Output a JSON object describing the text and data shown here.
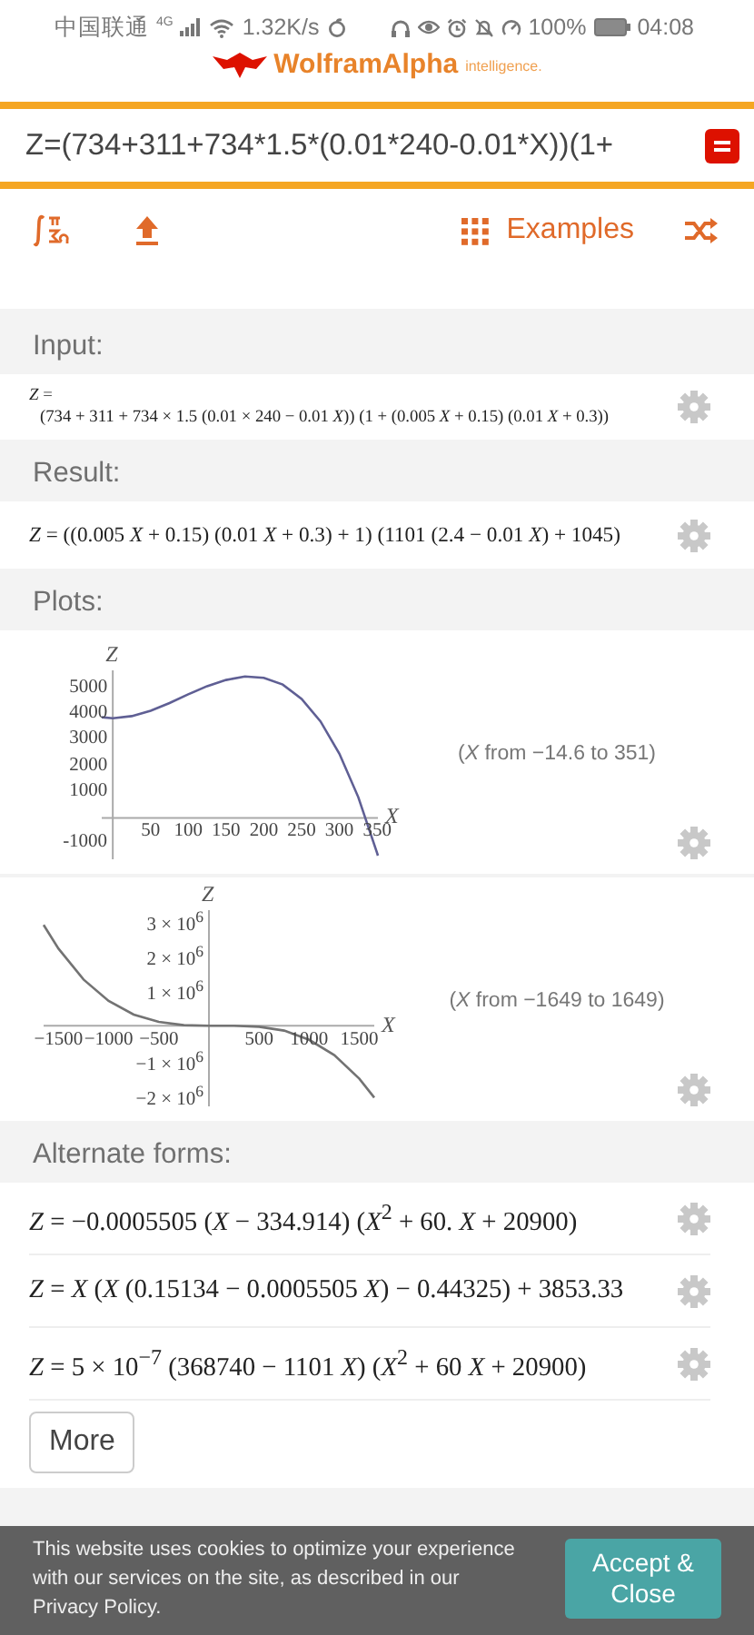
{
  "status_bar": {
    "carrier": "中国联通",
    "network": "4G",
    "speed": "1.32K/s",
    "battery": "100%",
    "time": "04:08"
  },
  "header": {
    "logo": "WolframAlpha",
    "tagline": "intelligence."
  },
  "search": {
    "value": "Z=(734+311+734*1.5*(0.01*240-0.01*X))(1+"
  },
  "toolbar": {
    "examples": "Examples"
  },
  "pods": [
    {
      "kind": "formula",
      "title": "Input:",
      "lines": [
        "*Z* =",
        "(734 + 311 + 734 × 1.5 (0.01 × 240 − 0.01 *X*)) (1 + (0.005 *X* + 0.15) (0.01 *X* + 0.3))"
      ]
    },
    {
      "kind": "formula",
      "title": "Result:",
      "lines": [
        "*Z* = ((0.005 *X* + 0.15) (0.01 *X* + 0.3) + 1) (1101 (2.4 − 0.01 *X*) + 1045)"
      ]
    },
    {
      "kind": "plots",
      "title": "Plots:",
      "plots": [
        {
          "range_note": "(*X* from −14.6 to 351)",
          "chart_data": {
            "type": "line",
            "xlabel": "X",
            "ylabel": "Z",
            "x": [
              -14.6,
              0,
              25,
              50,
              75,
              100,
              125,
              150,
              175,
              200,
              225,
              250,
              275,
              300,
              325,
              350,
              351
            ],
            "series": [
              {
                "color": "#5f5f94",
                "values": [
                  3890,
                  3850,
                  3930,
                  4140,
                  4440,
                  4770,
                  5090,
                  5330,
                  5460,
                  5410,
                  5150,
                  4600,
                  3730,
                  2480,
                  800,
                  -1370,
                  -1460
                ]
              }
            ],
            "xlim": [
              -14.6,
              351
            ],
            "ylim": [
              -1600,
              5700
            ],
            "xticks": [
              50,
              100,
              150,
              200,
              250,
              300,
              350
            ],
            "yticks": [
              {
                "value": -1000,
                "label": "-1000"
              },
              1000,
              2000,
              3000,
              4000,
              5000
            ]
          }
        },
        {
          "range_note": "(*X* from −1649 to 1649)",
          "chart_data": {
            "type": "line",
            "xlabel": "X",
            "ylabel": "Z",
            "x": [
              -1649,
              -1500,
              -1250,
              -1000,
              -750,
              -500,
              -250,
              0,
              250,
              500,
              750,
              1000,
              1250,
              1500,
              1649
            ],
            "series": [
              {
                "color": "#737373",
                "values": [
                  2880000,
                  2200000,
                  1320000,
                  710000,
                  320000,
                  110000,
                  20000,
                  0,
                  0,
                  -30000,
                  -140000,
                  -400000,
                  -840000,
                  -1510000,
                  -2050000
                ]
              }
            ],
            "xlim": [
              -1649,
              1649
            ],
            "ylim": [
              -2300000,
              3300000
            ],
            "xticks": [
              {
                "value": -1500,
                "label": "−1500"
              },
              {
                "value": -1000,
                "label": "−1000"
              },
              {
                "value": -500,
                "label": "−500"
              },
              500,
              1000,
              1500
            ],
            "yticks": [
              {
                "value": 3000000,
                "label": "3 × 10$^{6}$"
              },
              {
                "value": 2000000,
                "label": "2 × 10$^{6}$"
              },
              {
                "value": 1000000,
                "label": "1 × 10$^{6}$"
              },
              {
                "value": -1000000,
                "label": "−1 × 10$^{6}$"
              },
              {
                "value": -2000000,
                "label": "−2 × 10$^{6}$"
              }
            ]
          }
        }
      ]
    },
    {
      "kind": "list",
      "title": "Alternate forms:",
      "rows": [
        "*Z* = −0.0005505 (*X* − 334.914) (*X*$^{2}$ + 60. *X* + 20900)",
        "*Z* = *X* (*X* (0.15134 − 0.0005505 *X*) − 0.44325) + 3853.33",
        "*Z* = 5 × 10$^{−7}$ (368740 − 1101 *X*) (*X*$^{2}$ + 60 *X* + 20900)"
      ],
      "more": "More"
    }
  ],
  "cookie": {
    "text": "This website uses cookies to optimize your experience with our services on the site, as described in our",
    "link": "Privacy Policy",
    "end": ".",
    "button": "Accept & Close"
  }
}
